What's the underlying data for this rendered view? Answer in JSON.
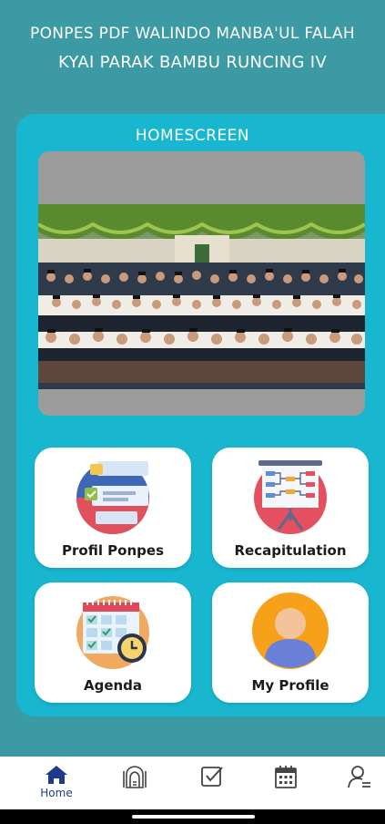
{
  "header": {
    "line1": "PONPES PDF WALINDO MANBA'UL FALAH",
    "line2": "KYAI PARAK BAMBU RUNCING IV"
  },
  "card": {
    "title": "HOMESCREEN",
    "photo_icon": "group-photo-image"
  },
  "tiles": [
    {
      "label": "Profil Ponpes",
      "icon": "checklist-document-icon"
    },
    {
      "label": "Recapitulation",
      "icon": "flowchart-presentation-icon"
    },
    {
      "label": "Agenda",
      "icon": "calendar-clock-icon"
    },
    {
      "label": "My Profile",
      "icon": "user-avatar-icon"
    }
  ],
  "nav": {
    "active_color": "#1e3a8a",
    "items": [
      {
        "label": "Home",
        "icon": "home-icon",
        "active": true
      },
      {
        "label": "",
        "icon": "mosque-icon",
        "active": false
      },
      {
        "label": "",
        "icon": "checkbox-icon",
        "active": false
      },
      {
        "label": "",
        "icon": "calendar-icon",
        "active": false
      },
      {
        "label": "",
        "icon": "user-list-icon",
        "active": false
      }
    ]
  },
  "colors": {
    "background": "#3b9aa3",
    "card": "#19b7cf",
    "photo_frame": "#9c9c9c"
  }
}
